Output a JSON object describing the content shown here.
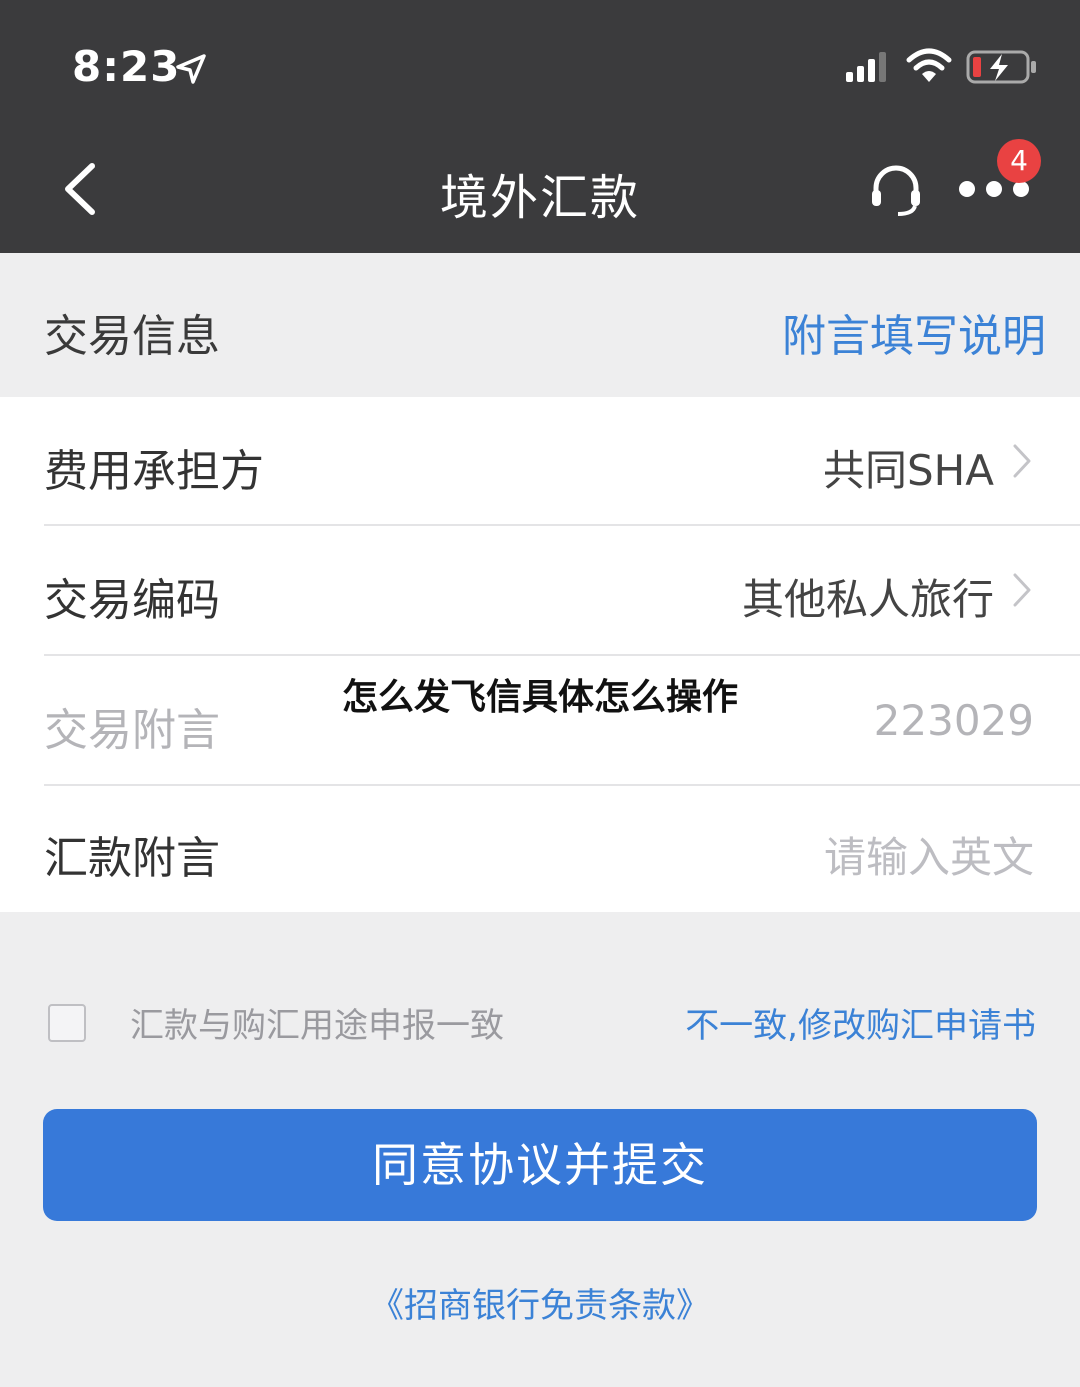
{
  "status_bar": {
    "time": "8:23"
  },
  "nav": {
    "title": "境外汇款",
    "badge_count": "4"
  },
  "section": {
    "title": "交易信息",
    "link": "附言填写说明"
  },
  "rows": [
    {
      "label": "费用承担方",
      "value": "共同SHA"
    },
    {
      "label": "交易编码",
      "value": "其他私人旅行"
    },
    {
      "label": "交易附言",
      "value": "223029"
    },
    {
      "label": "汇款附言",
      "placeholder": "请输入英文"
    }
  ],
  "overlay_text": "怎么发飞信具体怎么操作",
  "declaration": {
    "label": "汇款与购汇用途申报一致",
    "link": "不一致,修改购汇申请书"
  },
  "submit_label": "同意协议并提交",
  "disclaimer_link": "《招商银行免责条款》",
  "colors": {
    "accent": "#3779d9",
    "link": "#3b82d6",
    "badge": "#e94242",
    "header": "#3b3b3d"
  }
}
